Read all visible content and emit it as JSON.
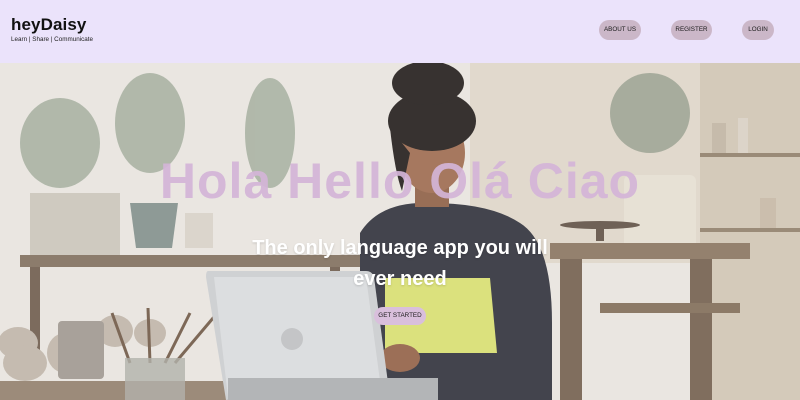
{
  "brand": {
    "name": "heyDaisy",
    "tagline": "Learn | Share | Communicate"
  },
  "nav": {
    "about": "ABOUT US",
    "register": "REGISTER",
    "login": "LOGIN"
  },
  "hero": {
    "headline": "Hola Hello Olá Ciao",
    "subheadline": "The only language app you will ever need",
    "cta": "GET STARTED"
  },
  "colors": {
    "header_bg": "#ebe3fb",
    "nav_button_bg": "#cbb7c8",
    "headline": "#d4b5d8",
    "cta_bg": "#d9bfdc"
  }
}
